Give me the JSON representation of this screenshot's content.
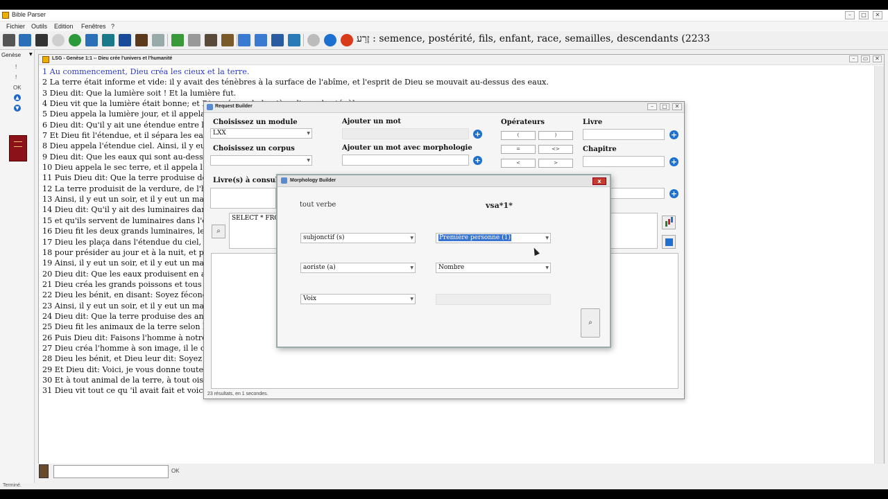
{
  "window": {
    "title": "Bible Parser"
  },
  "menu": [
    "Fichier",
    "Outils",
    "Edition",
    "Fenêtres",
    "?"
  ],
  "toolbar": {
    "lookup_text": "זֶרַע : semence, postérité, fils, enfant, race, semailles, descendants (2233"
  },
  "sidebar": {
    "book": "Genèse",
    "items": [
      "!",
      "!",
      "OK"
    ]
  },
  "document": {
    "title": "LSG - Genèse 1:1 -- Dieu crée l'univers et l'humanité",
    "verses": [
      "1 Au commencement, Dieu créa les cieux et la terre.",
      "2 La terre était informe et vide: il y avait des ténèbres à la surface de l'abîme, et l'esprit de Dieu se mouvait au-dessus des eaux.",
      "3 Dieu dit: Que la lumière soit ! Et la lumière fut.",
      "4 Dieu vit que la lumière était bonne; et Dieu sépara la lumière d'avec les ténèbres.",
      "5 Dieu appela la lumière jour, et il appela les",
      "6 Dieu dit: Qu'il y ait une étendue entre les ea",
      "7 Et Dieu fit l'étendue, et il sépara les eaux qu",
      "8 Dieu appela l'étendue ciel. Ainsi, il y eut un",
      "9 Dieu dit: Que les eaux qui sont au-dessous d",
      "10 Dieu appela le sec terre, et il appela l'amas",
      "11 Puis Dieu dit: Que la terre produise de la v                                                                                                                             re. Et cela fut ainsi.",
      "12 La terre produisit de la verdure, de l'herbe                                                                                                                           ela était bon.",
      "13 Ainsi, il y eut un soir, et il y eut un matin: c",
      "14 Dieu dit: Qu'il y ait des luminaires dans l'ét",
      "15 et qu'ils servent de luminaires dans l'éten",
      "16 Dieu fit les deux grands luminaires, le plus",
      "17 Dieu les plaça dans l'étendue du ciel, pour",
      "18 pour présider au jour et à la nuit, et pour",
      "19 Ainsi, il y eut un soir, et il y eut un matin: c",
      "20 Dieu dit: Que les eaux produisent en abonc",
      "21 Dieu créa les grands poissons et tous les an                                                                                                                         èce. Dieu vit que cela était bon.",
      "22 Dieu les bénit, en disant: Soyez féconds, m",
      "23 Ainsi, il y eut un soir, et il y eut un matin: c",
      "24 Dieu dit: Que la terre produise des animau",
      "25 Dieu fit les animaux de la terre selon leur e",
      "26 Puis Dieu dit: Faisons l'homme à notre ima                                                                                                                         ous les reptiles qui rampent sur la terre.",
      "27 Dieu créa l'homme à son image, il le créa à",
      "28 Dieu les bénit, et Dieu leur dit: Soyez fécon                                                                                                                       l se meut sur la terre.",
      "29 Et Dieu dit: Voici, je vous donne toute herb                                                                                                                       sera votre nourriture.",
      "30 Et à tout animal de la terre, à tout oiseau c",
      "31 Dieu vit tout ce qu 'il avait fait et voici, cel"
    ]
  },
  "request_builder": {
    "title": "Request Builder",
    "module_label": "Choisissez un module",
    "module_value": "LXX",
    "corpus_label": "Choisissez un corpus",
    "corpus_value": "",
    "add_word_label": "Ajouter un mot",
    "add_word_morph_label": "Ajouter un mot avec morphologie",
    "operators_label": "Opérateurs",
    "operators": [
      "(",
      ")",
      "=",
      "<>",
      "<",
      ">"
    ],
    "book_label": "Livre",
    "chapter_label": "Chapitre",
    "books_consult_label": "Livre(s) à consulte",
    "query": "SELECT * FROM",
    "status": "23 résultats, en 1 secondes."
  },
  "morphology_builder": {
    "title": "Morphology Builder",
    "description": "tout verbe",
    "code": "vsa*1*",
    "mood": "subjonctif (s)",
    "person": "Première personne (1)",
    "tense": "aoriste (a)",
    "number": "Nombre",
    "voice": "Voix"
  },
  "bottom": {
    "ok_label": "OK",
    "status": "Terminé."
  }
}
